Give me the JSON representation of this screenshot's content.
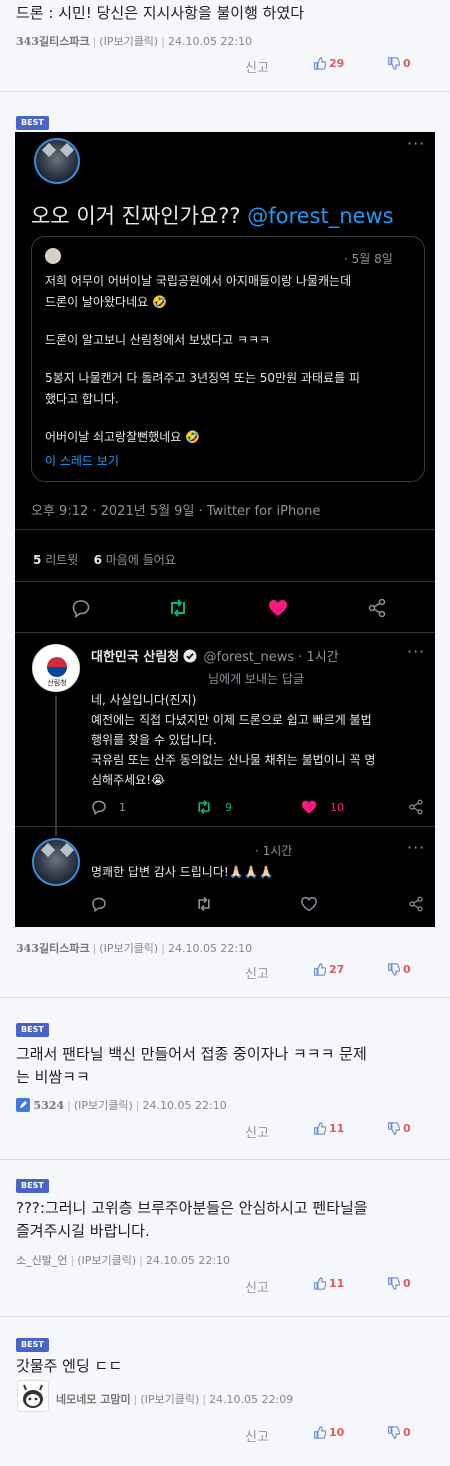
{
  "comments": [
    {
      "text": "드론 : 시민! 당신은 지시사항을 불이행 하였다",
      "author": "343길티스파크",
      "ip": "(IP보기클릭)",
      "date": "24.10.05 22:10",
      "report": "신고",
      "up": "29",
      "down": "0"
    },
    {
      "badge": "BEST",
      "author": "343길티스파크",
      "ip": "(IP보기클릭)",
      "date": "24.10.05 22:10",
      "report": "신고",
      "up": "27",
      "down": "0"
    },
    {
      "badge": "BEST",
      "text_line1": "그래서 팬타닐 백신 만들어서 접종 중이자나 ㅋㅋㅋ 문제",
      "text_line2": "는 비쌈ㅋㅋ",
      "author": "5324",
      "ip": "(IP보기클릭)",
      "date": "24.10.05 22:10",
      "report": "신고",
      "up": "11",
      "down": "0"
    },
    {
      "badge": "BEST",
      "text_line1": "???:그러니 고위층 브루주아분들은 안심하시고 펜타닐을",
      "text_line2": "즐겨주시길 바랍니다.",
      "author": "소_신발_언",
      "ip": "(IP보기클릭)",
      "date": "24.10.05 22:10",
      "report": "신고",
      "up": "11",
      "down": "0"
    },
    {
      "badge": "BEST",
      "text": "갓물주 엔딩 ㄷㄷ",
      "author": "네모네모 고맘미",
      "ip": "(IP보기클릭)",
      "date": "24.10.05 22:09",
      "report": "신고",
      "up": "10",
      "down": "0"
    }
  ],
  "tweet": {
    "main_text": "오오 이거 진짜인가요?? ",
    "mention": "@forest_news",
    "quote": {
      "date": "· 5월 8일",
      "line1": "저희 어무이 어버이날 국립공원에서 아지매들이랑 나물캐는데",
      "line2": "드론이 날아왔다네요 🤣",
      "line3": "드론이 알고보니 산림청에서 보냈다고 ㅋㅋㅋ",
      "line4": "5봉지 나물캔거 다 돌려주고 3년징역 또는 50만원 과태료를 피",
      "line5": "했다고 합니다.",
      "line6": "어버이날 쇠고랑찰뻔했네요 🤣",
      "thread_link": "이 스레드 보기"
    },
    "timestamp": "오후 9:12 · 2021년 5월 9일 · Twitter for iPhone",
    "retweets": "5",
    "retweets_label": "리트윗",
    "likes": "6",
    "likes_label": "마음에 들어요",
    "reply1": {
      "name": "대한민국 산림청",
      "handle": "@forest_news · 1시간",
      "logo_text": "산림청",
      "reply_to": "님에게 보내는 답글",
      "line1": "네, 사실입니다(진지)",
      "line2": "예전에는 직접 다녔지만 이제 드론으로 쉽고 빠르게 불법",
      "line3": "행위를 찾을 수 있답니다.",
      "line4": "국유림 또는 산주 동의없는 산나물 채취는 불법이니 꼭 명",
      "line5": "심해주세요!😭",
      "replies": "1",
      "retweets": "9",
      "likes": "10"
    },
    "reply2": {
      "time": "· 1시간",
      "text": "명쾌한 답변 감사 드립니다!🙏🏻🙏🏻🙏🏻"
    }
  },
  "colors": {
    "best_badge": "#4a63c9",
    "vote_count": "#e05a5a",
    "vote_icon": "#6b8fd6",
    "twitter_link": "#1d9bf0",
    "retweet_green": "#00ba7c",
    "like_pink": "#f91880"
  }
}
